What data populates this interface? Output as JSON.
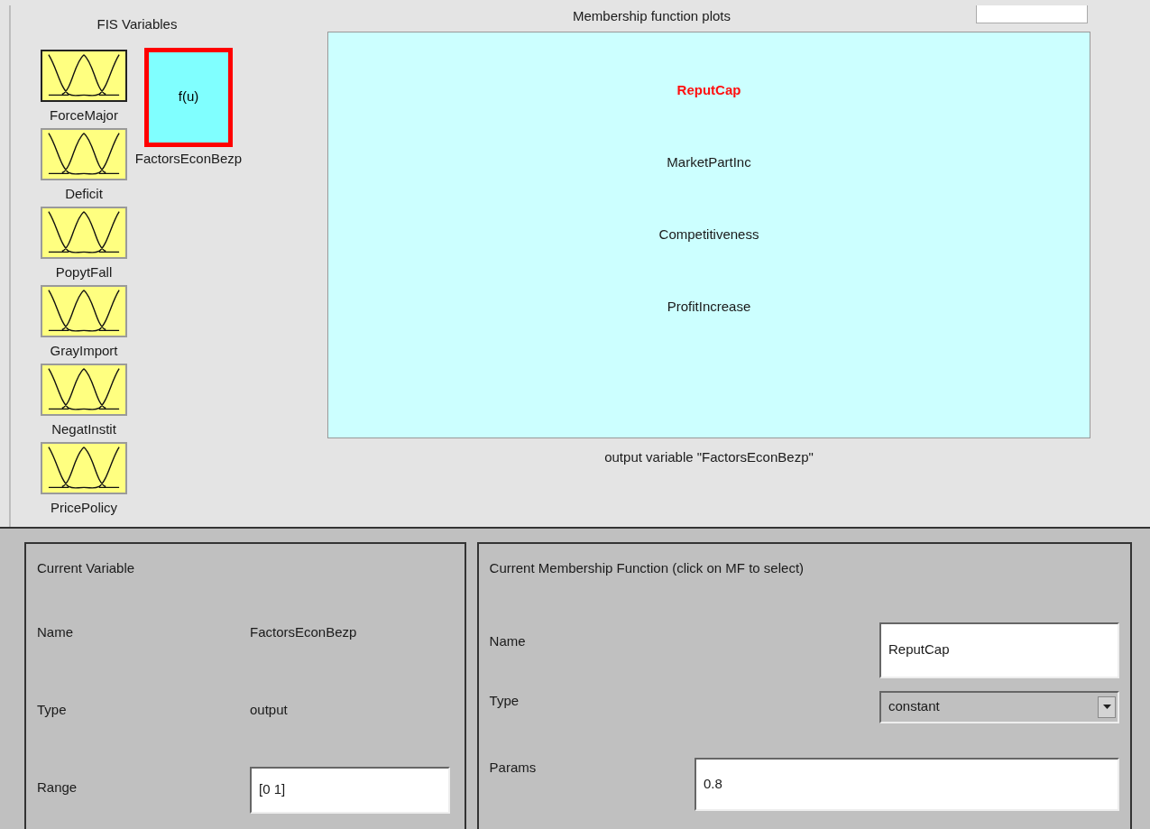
{
  "fis_variables": {
    "title": "FIS Variables",
    "inputs": [
      {
        "name": "ForceMajor",
        "focused": true
      },
      {
        "name": "Deficit",
        "focused": false
      },
      {
        "name": "PopytFall",
        "focused": false
      },
      {
        "name": "GrayImport",
        "focused": false
      },
      {
        "name": "NegatInstit",
        "focused": false
      },
      {
        "name": "PricePolicy",
        "focused": false
      }
    ],
    "outputs": [
      {
        "name": "FactorsEconBezp",
        "label": "f(u)",
        "selected": true
      }
    ]
  },
  "mf_plots": {
    "title": "Membership function plots",
    "functions": [
      {
        "name": "ReputCap",
        "selected": true
      },
      {
        "name": "MarketPartInc",
        "selected": false
      },
      {
        "name": "Competitiveness",
        "selected": false
      },
      {
        "name": "ProfitIncrease",
        "selected": false
      }
    ],
    "caption": "output variable \"FactorsEconBezp\""
  },
  "current_variable": {
    "title": "Current Variable",
    "fields": [
      {
        "label": "Name",
        "value": "FactorsEconBezp",
        "kind": "text"
      },
      {
        "label": "Type",
        "value": "output",
        "kind": "text"
      },
      {
        "label": "Range",
        "value": "[0 1]",
        "kind": "input"
      }
    ]
  },
  "current_mf": {
    "title": "Current Membership Function (click on MF to select)",
    "name": {
      "label": "Name",
      "value": "ReputCap"
    },
    "type": {
      "label": "Type",
      "value": "constant"
    },
    "params": {
      "label": "Params",
      "value": "0.8"
    }
  }
}
